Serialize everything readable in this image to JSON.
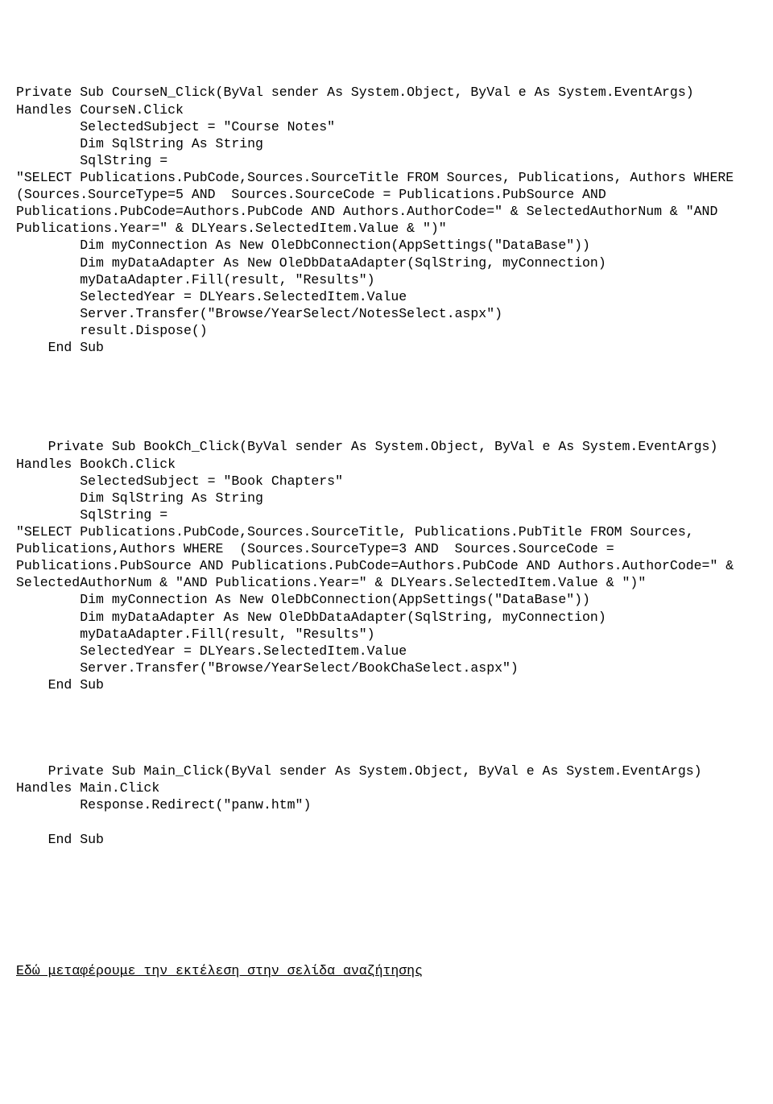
{
  "block1": "Private Sub CourseN_Click(ByVal sender As System.Object, ByVal e As System.EventArgs) Handles CourseN.Click\n        SelectedSubject = \"Course Notes\"\n        Dim SqlString As String\n        SqlString = \n\"SELECT Publications.PubCode,Sources.SourceTitle FROM Sources, Publications, Authors WHERE  (Sources.SourceType=5 AND  Sources.SourceCode = Publications.PubSource AND Publications.PubCode=Authors.PubCode AND Authors.AuthorCode=\" & SelectedAuthorNum & \"AND Publications.Year=\" & DLYears.SelectedItem.Value & \")\"\n        Dim myConnection As New OleDbConnection(AppSettings(\"DataBase\"))\n        Dim myDataAdapter As New OleDbDataAdapter(SqlString, myConnection)\n        myDataAdapter.Fill(result, \"Results\")\n        SelectedYear = DLYears.SelectedItem.Value\n        Server.Transfer(\"Browse/YearSelect/NotesSelect.aspx\")\n        result.Dispose()\n    End Sub",
  "block2": "    Private Sub BookCh_Click(ByVal sender As System.Object, ByVal e As System.EventArgs) Handles BookCh.Click\n        SelectedSubject = \"Book Chapters\"\n        Dim SqlString As String\n        SqlString = \n\"SELECT Publications.PubCode,Sources.SourceTitle, Publications.PubTitle FROM Sources, Publications,Authors WHERE  (Sources.SourceType=3 AND  Sources.SourceCode = Publications.PubSource AND Publications.PubCode=Authors.PubCode AND Authors.AuthorCode=\" & SelectedAuthorNum & \"AND Publications.Year=\" & DLYears.SelectedItem.Value & \")\"\n        Dim myConnection As New OleDbConnection(AppSettings(\"DataBase\"))\n        Dim myDataAdapter As New OleDbDataAdapter(SqlString, myConnection)\n        myDataAdapter.Fill(result, \"Results\")\n        SelectedYear = DLYears.SelectedItem.Value\n        Server.Transfer(\"Browse/YearSelect/BookChaSelect.aspx\")\n    End Sub",
  "block3": "    Private Sub Main_Click(ByVal sender As System.Object, ByVal e As System.EventArgs) Handles Main.Click\n        Response.Redirect(\"panw.htm\")\n\n    End Sub",
  "footer": "Εδώ μεταφέρουμε την εκτέλεση στην σελίδα αναζήτησης"
}
